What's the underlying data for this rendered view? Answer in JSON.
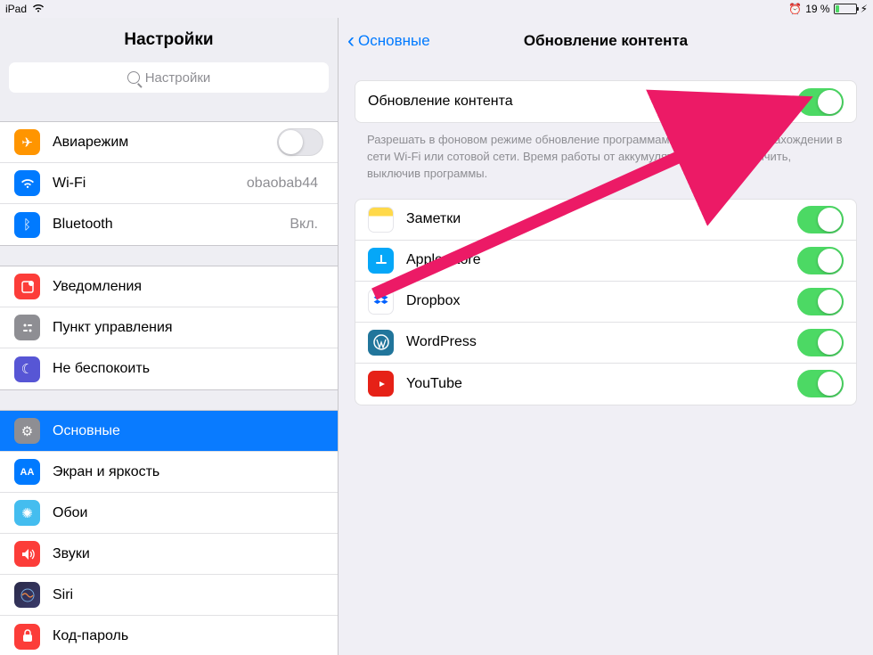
{
  "status": {
    "device": "iPad",
    "battery_pct": "19 %"
  },
  "sidebar": {
    "title": "Настройки",
    "search_placeholder": "Настройки",
    "group1": {
      "airplane": "Авиарежим",
      "wifi": "Wi-Fi",
      "wifi_detail": "obaobab44",
      "bluetooth": "Bluetooth",
      "bluetooth_detail": "Вкл."
    },
    "group2": {
      "notif": "Уведомления",
      "cc": "Пункт управления",
      "dnd": "Не беспокоить"
    },
    "group3": {
      "general": "Основные",
      "display": "Экран и яркость",
      "wallpaper": "Обои",
      "sound": "Звуки",
      "siri": "Siri",
      "passcode": "Код-пароль"
    }
  },
  "detail": {
    "back": "Основные",
    "title": "Обновление контента",
    "master_label": "Обновление контента",
    "help_text": "Разрешать в фоновом режиме обновление программами их контента при нахождении в сети Wi-Fi или сотовой сети. Время работы от аккумулятора можно увеличить, выключив программы.",
    "apps": [
      {
        "name": "Заметки"
      },
      {
        "name": "Apple Store"
      },
      {
        "name": "Dropbox"
      },
      {
        "name": "WordPress"
      },
      {
        "name": "YouTube"
      }
    ]
  }
}
